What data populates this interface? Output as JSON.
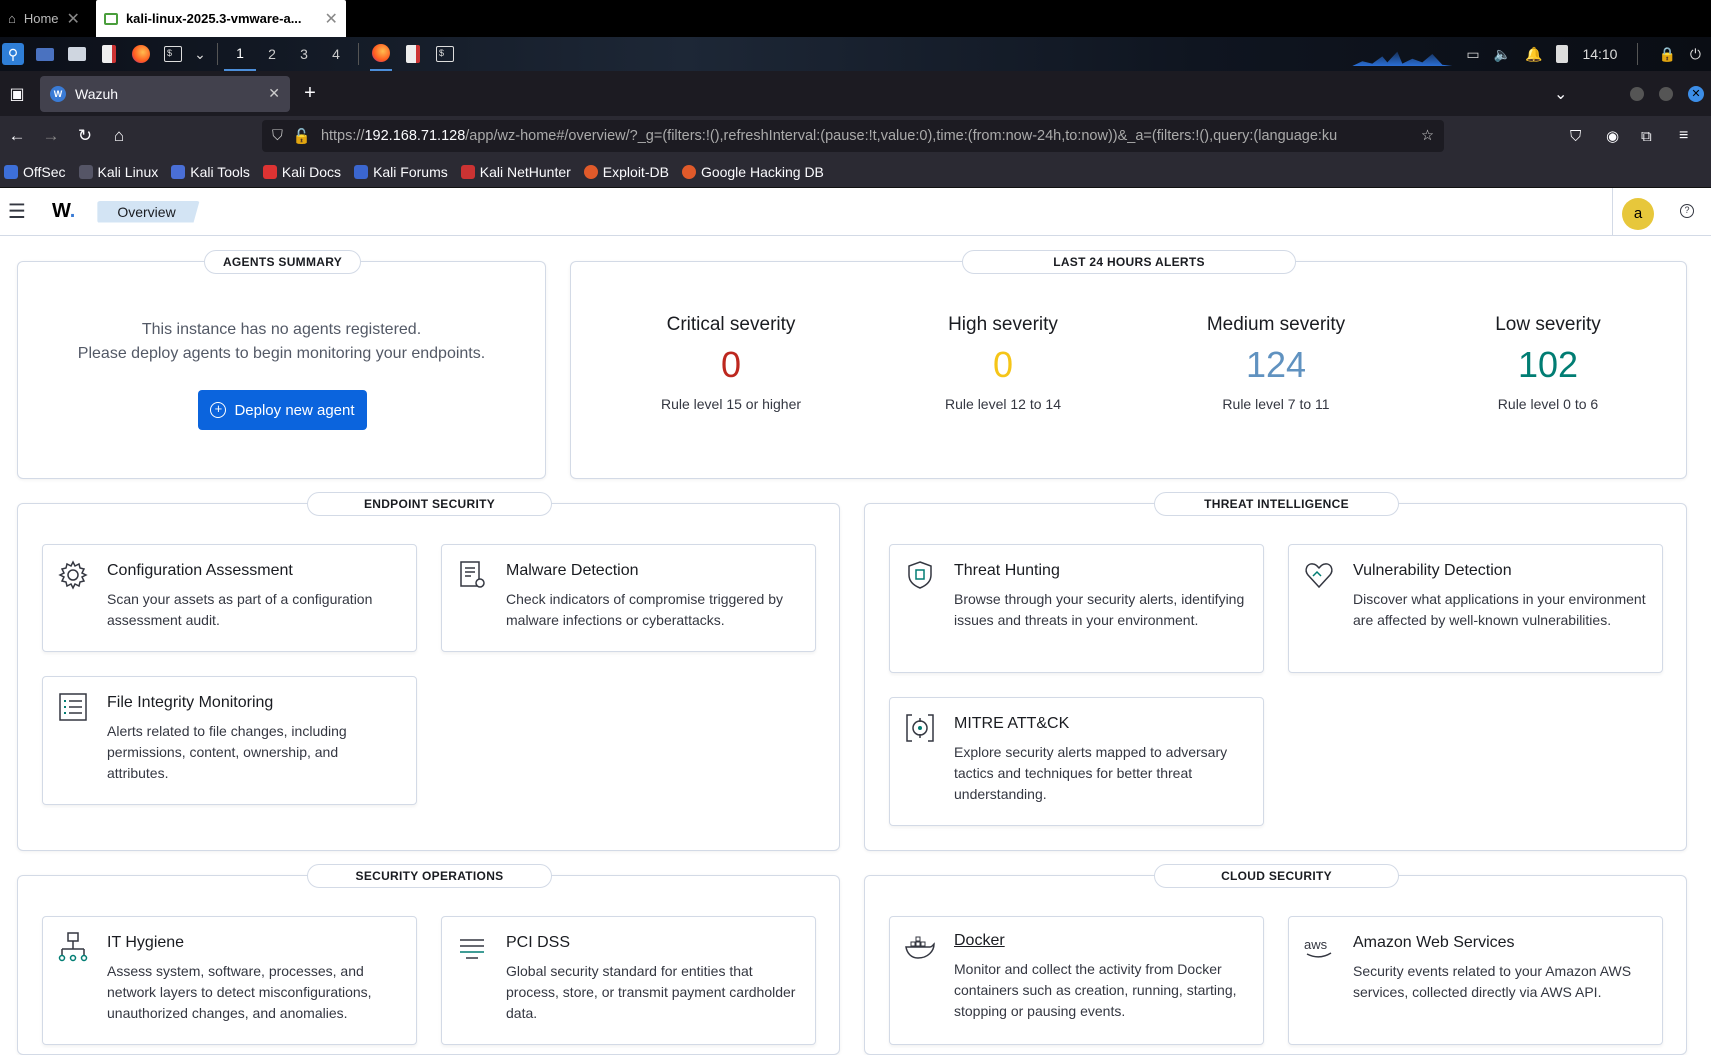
{
  "vm_tabs": [
    {
      "label": "Home"
    },
    {
      "label": "kali-linux-2025.3-vmware-a..."
    }
  ],
  "panel": {
    "workspaces": [
      "1",
      "2",
      "3",
      "4"
    ],
    "clock": "14:10"
  },
  "browser": {
    "tab_title": "Wazuh",
    "url_prefix": "https://",
    "url_host": "192.168.71.128",
    "url_rest": "/app/wz-home#/overview/?_g=(filters:!(),refreshInterval:(pause:!t,value:0),time:(from:now-24h,to:now))&_a=(filters:!(),query:(language:ku",
    "bookmarks": [
      "OffSec",
      "Kali Linux",
      "Kali Tools",
      "Kali Docs",
      "Kali Forums",
      "Kali NetHunter",
      "Exploit-DB",
      "Google Hacking DB"
    ]
  },
  "app": {
    "breadcrumb": "Overview",
    "avatar_letter": "a"
  },
  "agents_summary": {
    "title": "AGENTS SUMMARY",
    "line1": "This instance has no agents registered.",
    "line2": "Please deploy agents to begin monitoring your endpoints.",
    "button": "Deploy new agent"
  },
  "alerts": {
    "title": "LAST 24 HOURS ALERTS",
    "items": [
      {
        "label": "Critical severity",
        "value": "0",
        "rule": "Rule level 15 or higher",
        "color": "#bd271e"
      },
      {
        "label": "High severity",
        "value": "0",
        "rule": "Rule level 12 to 14",
        "color": "#f5c518"
      },
      {
        "label": "Medium severity",
        "value": "124",
        "rule": "Rule level 7 to 11",
        "color": "#6092c0"
      },
      {
        "label": "Low severity",
        "value": "102",
        "rule": "Rule level 0 to 6",
        "color": "#017d73"
      }
    ]
  },
  "sections": {
    "endpoint": {
      "title": "ENDPOINT SECURITY",
      "cards": [
        {
          "title": "Configuration Assessment",
          "desc": "Scan your assets as part of a configuration assessment audit."
        },
        {
          "title": "Malware Detection",
          "desc": "Check indicators of compromise triggered by malware infections or cyberattacks."
        },
        {
          "title": "File Integrity Monitoring",
          "desc": "Alerts related to file changes, including permissions, content, ownership, and attributes."
        }
      ]
    },
    "threat": {
      "title": "THREAT INTELLIGENCE",
      "cards": [
        {
          "title": "Threat Hunting",
          "desc": "Browse through your security alerts, identifying issues and threats in your environment."
        },
        {
          "title": "Vulnerability Detection",
          "desc": "Discover what applications in your environment are affected by well-known vulnerabilities."
        },
        {
          "title": "MITRE ATT&CK",
          "desc": "Explore security alerts mapped to adversary tactics and techniques for better threat understanding."
        }
      ]
    },
    "secops": {
      "title": "SECURITY OPERATIONS",
      "cards": [
        {
          "title": "IT Hygiene",
          "desc": "Assess system, software, processes, and network layers to detect misconfigurations, unauthorized changes, and anomalies."
        },
        {
          "title": "PCI DSS",
          "desc": "Global security standard for entities that process, store, or transmit payment cardholder data."
        }
      ]
    },
    "cloud": {
      "title": "CLOUD SECURITY",
      "cards": [
        {
          "title": "Docker",
          "desc": "Monitor and collect the activity from Docker containers such as creation, running, starting, stopping or pausing events."
        },
        {
          "title": "Amazon Web Services",
          "desc": "Security events related to your Amazon AWS services, collected directly via AWS API."
        }
      ]
    }
  }
}
